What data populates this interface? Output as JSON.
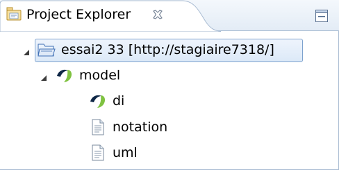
{
  "view": {
    "tab_label": "Project Explorer",
    "icons": {
      "tab": "project-explorer-icon",
      "close": "close-icon",
      "minimize": "minimize-icon"
    }
  },
  "tree": {
    "project": {
      "label": "essai2 33 [http://stagiaire7318/]",
      "icon": "project-folder-icon",
      "expanded": true
    },
    "model": {
      "label": "model",
      "icon": "papyrus-model-icon",
      "expanded": true
    },
    "children": [
      {
        "label": "di",
        "icon": "papyrus-model-icon"
      },
      {
        "label": "notation",
        "icon": "file-icon"
      },
      {
        "label": "uml",
        "icon": "file-icon"
      }
    ]
  },
  "colors": {
    "border": "#a7bad1",
    "selection_bg": "#dce9f8",
    "selection_border": "#7da2ce",
    "model_green": "#7fc241",
    "model_dark": "#0e2746"
  }
}
